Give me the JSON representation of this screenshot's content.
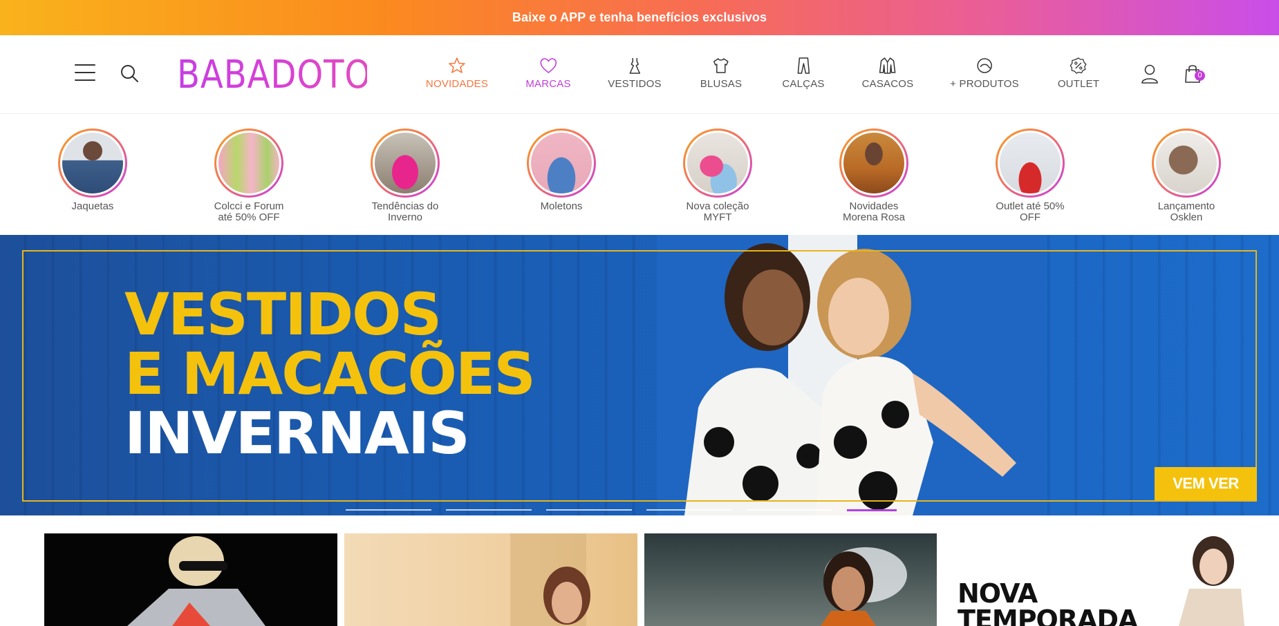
{
  "promo": {
    "text": "Baixe o APP e tenha benefícios exclusivos"
  },
  "header": {
    "logo": "BABADOTOP",
    "cart_count": "0",
    "nav": [
      {
        "label": "NOVIDADES",
        "icon": "star-icon"
      },
      {
        "label": "MARCAS",
        "icon": "heart-icon"
      },
      {
        "label": "VESTIDOS",
        "icon": "dress-icon"
      },
      {
        "label": "BLUSAS",
        "icon": "tshirt-icon"
      },
      {
        "label": "CALÇAS",
        "icon": "pants-icon"
      },
      {
        "label": "CASACOS",
        "icon": "coat-icon"
      },
      {
        "label": "+ PRODUTOS",
        "icon": "cap-icon"
      },
      {
        "label": "OUTLET",
        "icon": "percent-badge-icon"
      }
    ]
  },
  "stories": [
    {
      "line1": "Jaquetas",
      "line2": ""
    },
    {
      "line1": "Colcci e Forum",
      "line2": "até 50% OFF"
    },
    {
      "line1": "Tendências do",
      "line2": "Inverno"
    },
    {
      "line1": "Moletons",
      "line2": ""
    },
    {
      "line1": "Nova coleção",
      "line2": "MYFT"
    },
    {
      "line1": "Novidades",
      "line2": "Morena Rosa"
    },
    {
      "line1": "Outlet até 50%",
      "line2": "OFF"
    },
    {
      "line1": "Lançamento",
      "line2": "Osklen"
    }
  ],
  "hero": {
    "line1": "VESTIDOS",
    "line2": "E MACACÕES",
    "line3": "INVERNAIS",
    "cta": "VEM VER",
    "slides_total": 6,
    "active_slide": 6
  },
  "tiles": {
    "tile4_line1": "NOVA",
    "tile4_line2": "TEMPORADA"
  },
  "colors": {
    "brand": "#c33ddb",
    "accent_orange": "#f7763e",
    "banner_yellow": "#f4c20d",
    "banner_blue": "#1b5fb8"
  }
}
